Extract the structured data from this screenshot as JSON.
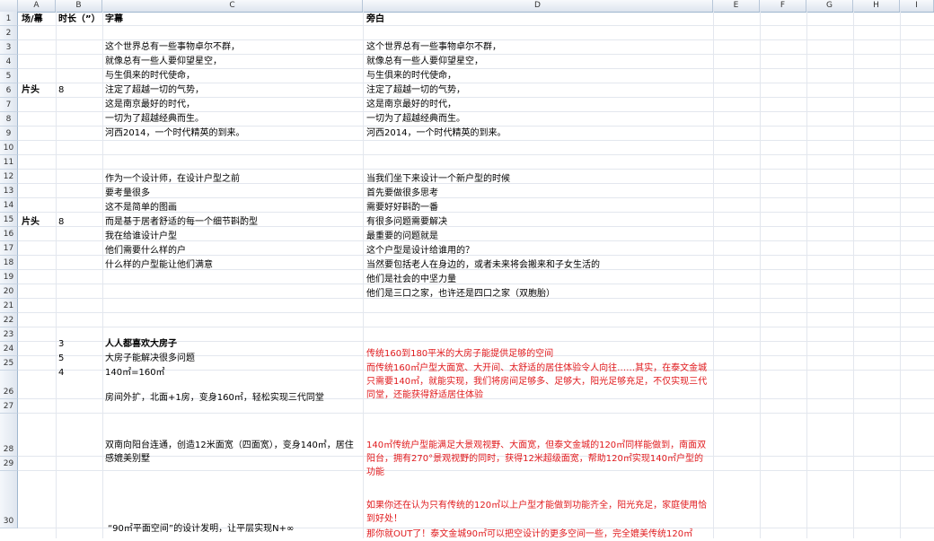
{
  "columns": [
    "A",
    "B",
    "C",
    "D",
    "E",
    "F",
    "G",
    "H",
    "I"
  ],
  "rows": [
    "1",
    "2",
    "3",
    "4",
    "5",
    "6",
    "7",
    "8",
    "9",
    "10",
    "11",
    "12",
    "13",
    "14",
    "15",
    "16",
    "17",
    "18",
    "19",
    "20",
    "21",
    "22",
    "23",
    "24",
    "25",
    "26",
    "27",
    "28",
    "29",
    "30"
  ],
  "header": {
    "scene": "场/幕",
    "duration": "时长（”）",
    "subtitle": "字幕",
    "narration": "旁白"
  },
  "block1": {
    "scene": "片头",
    "duration": "8",
    "subtitle_lines": [
      "这个世界总有一些事物卓尔不群，",
      "就像总有一些人要仰望星空，",
      "与生俱来的时代使命，",
      "注定了超越一切的气势，",
      "这是南京最好的时代，",
      "一切为了超越经典而生。",
      "河西2014，一个时代精英的到来。"
    ],
    "narration_lines": [
      "这个世界总有一些事物卓尔不群，",
      "就像总有一些人要仰望星空，",
      "与生俱来的时代使命，",
      "注定了超越一切的气势，",
      "这是南京最好的时代，",
      "一切为了超越经典而生。",
      "河西2014，一个时代精英的到来。"
    ]
  },
  "block2": {
    "scene": "片头",
    "duration": "8",
    "subtitle_lines": [
      "作为一个设计师，在设计户型之前",
      "要考量很多",
      "这不是简单的图画",
      "而是基于居者舒适的每一个细节斟酌型",
      "我在给谁设计户型",
      "他们需要什么样的户",
      "什么样的户型能让他们满意"
    ],
    "narration_lines": [
      "当我们坐下来设计一个新户型的时候",
      "首先要做很多思考",
      "需要好好斟酌一番",
      "有很多问题需要解决",
      "最重要的问题就是",
      "这个户型是设计给谁用的？",
      "当然要包括老人在身边的，或者未来将会搬来和子女生活的",
      "他们是社会的中坚力量",
      "他们是三口之家，也许还是四口之家（双胞胎）"
    ]
  },
  "block3": {
    "durations": [
      "3",
      "5",
      "4"
    ],
    "title": "人人都喜欢大房子",
    "line2": "大房子能解决很多问题",
    "line3": "140㎡=160㎡",
    "line4": "房间外扩，北面+1房，变身160㎡，轻松实现三代同堂",
    "red1": "传统160到180平米的大房子能提供足够的空间",
    "red2": "而传统160㎡户型大面宽、大开间、太舒适的居住体验令人向往……其实，在泰文金城只需要140㎡，就能实现，我们将房间足够多、足够大，阳光足够充足，不仅实现三代同堂，还能获得舒适居住体验"
  },
  "block4": {
    "subtitle": "双南向阳台连通，创造12米面宽（四面宽），变身140㎡，居住感媲美别墅",
    "red": "140㎡传统户型能满足大景观视野、大面宽，但泰文金城的120㎡同样能做到，南面双阳台，拥有270°景观视野的同时，获得12米超级面宽，帮助120㎡实现140㎡户型的功能"
  },
  "block5": {
    "subtitle": "“90㎡平面空间”的设计发明，让平层实现N+∞",
    "red1": "如果你还在认为只有传统的120㎡以上户型才能做到功能齐全，阳光充足，家庭使用恰到好处！",
    "red2": "那你就OUT了！泰文金城90㎡可以把空设计的更多空间一些，完全媲美传统120㎡"
  }
}
